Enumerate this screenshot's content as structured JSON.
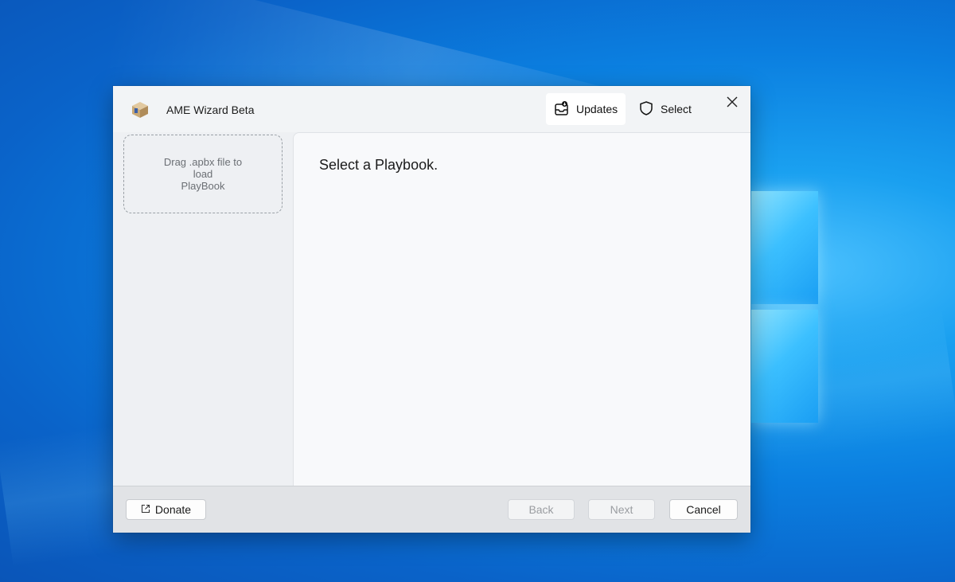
{
  "app": {
    "title": "AME Wizard Beta"
  },
  "toolbar": {
    "updates_label": "Updates",
    "select_label": "Select"
  },
  "sidebar": {
    "dropzone_text": "Drag .apbx file to\nload\nPlayBook"
  },
  "main": {
    "heading": "Select a Playbook."
  },
  "footer": {
    "donate_label": "Donate",
    "back_label": "Back",
    "next_label": "Next",
    "cancel_label": "Cancel"
  },
  "colors": {
    "desktop_accent": "#0b7fe0",
    "window_bg": "#eef0f3",
    "content_bg": "#f8f9fb",
    "footer_bg": "#e1e3e6"
  },
  "icons": {
    "app": "package-box-icon",
    "updates": "inbox-download-icon",
    "select": "shield-icon",
    "close": "close-icon",
    "donate": "external-link-icon"
  }
}
